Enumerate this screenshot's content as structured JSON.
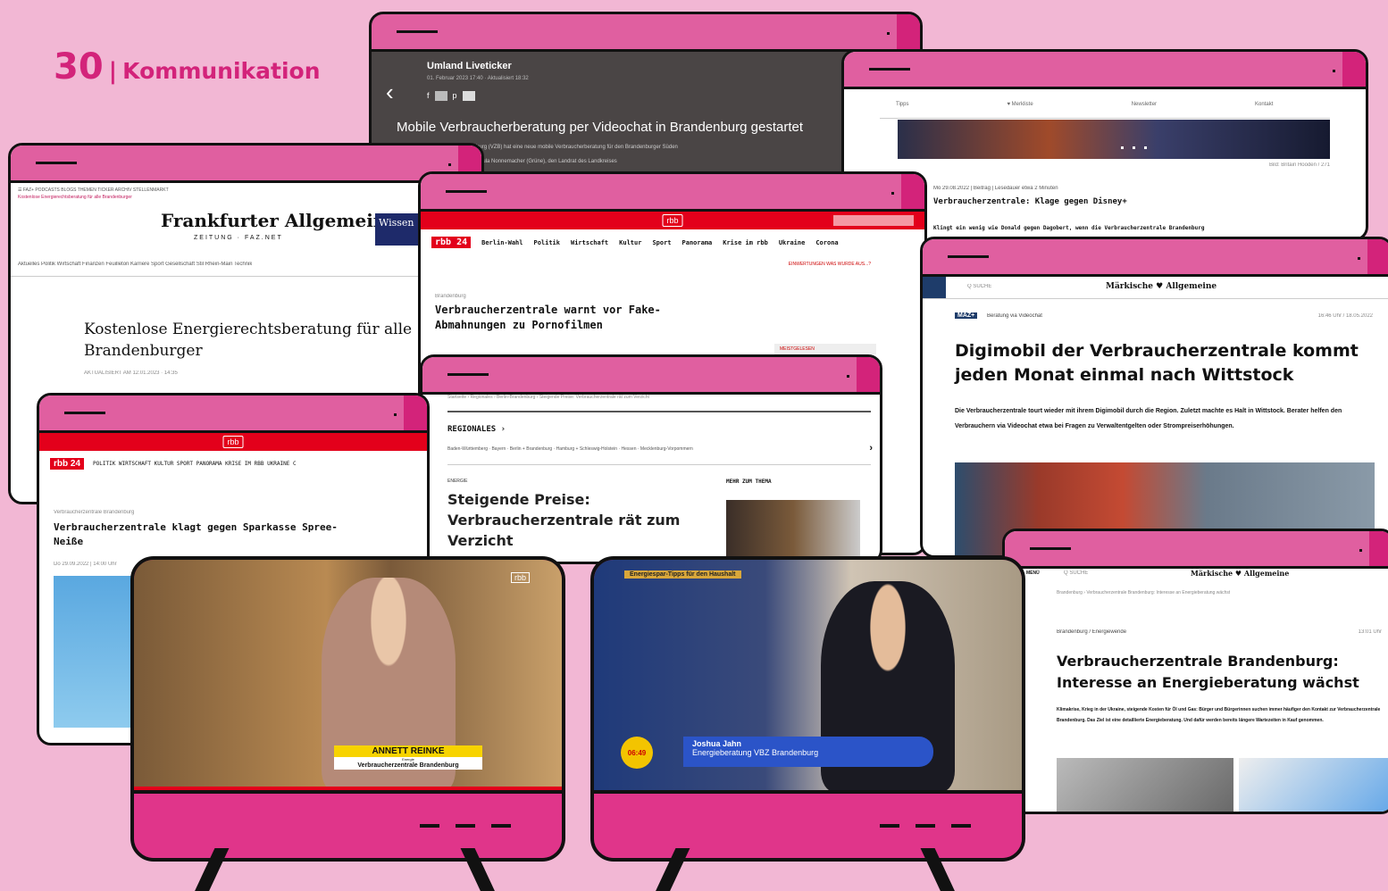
{
  "page_header": {
    "number": "30",
    "separator": "|",
    "section": "Kommunikation"
  },
  "win_live": {
    "kicker": "Umland Liveticker",
    "meta": "01. Februar 2023 17:40 · Aktualisiert 18:32",
    "headline": "Mobile Verbraucherberatung per Videochat in Brandenburg gestartet",
    "teaser1": "Die Verbraucherzentrale Brandenburg (VZB) hat eine neue mobile Verbraucherberatung für den Brandenburger Süden",
    "teaser2": "mit Verbraucherschutzministerin Ursula Nonnemacher (Grüne), den Landrat des Landkreises"
  },
  "win_disney": {
    "nav": [
      "Tipps",
      "♥ Merkliste",
      "Newsletter",
      "Kontakt"
    ],
    "credit": "Bild: Britain Hooden / 271",
    "meta": "Mo 29.08.2022 | Beitrag | Lesedauer etwa 2 Minuten",
    "headline": "Verbraucherzentrale: Klage gegen Disney+",
    "teaser": "Klingt ein wenig wie Donald gegen Dagobert, wenn die Verbraucherzentrale Brandenburg"
  },
  "win_faz": {
    "topnav": "☰  FAZ+  PODCASTS  BLOGS  THEMEN  TICKER  ARCHIV  STELLENMARKT",
    "breadcrumb": "Kostenlose Energierechtsberatung für alle Brandenburger",
    "logo": "Frankfurter Allgemeine",
    "logo_sub": "ZEITUNG · FAZ.NET",
    "ad": "Wissen · Gold we",
    "nav": "Aktuelles  Politik  Wirtschaft  Finanzen  Feuilleton  Karriere  Sport  Gesellschaft  Stil  Rhein-Main  Technik",
    "headline": "Kostenlose Energierechtsberatung für alle Brandenburger",
    "meta": "AKTUALISIERT AM 12.01.2023 · 14:35"
  },
  "win_rbb_fake": {
    "logo": "rbb",
    "badge": "rbb 24",
    "nav": [
      "Berlin-Wahl",
      "Politik",
      "Wirtschaft",
      "Kultur",
      "Sport",
      "Panorama",
      "Krise im rbb",
      "Ukraine",
      "Corona"
    ],
    "subnav": "EINWERTUNGEN    WAS WURDE AUS...?",
    "kicker": "Brandenburg",
    "headline": "Verbraucherzentrale warnt vor Fake-Abmahnungen zu Pornofilmen",
    "side": "MEISTGELESEN"
  },
  "win_maz1": {
    "search": "Q  SUCHE",
    "logo": "Märkische ♥ Allgemeine",
    "badge": "MAZ+",
    "kicker": "Beratung via Videochat",
    "time": "16:46 Uhr / 18.05.2022",
    "headline": "Digimobil der Verbraucherzentrale kommt jeden Monat einmal nach Wittstock",
    "teaser": "Die Verbraucherzentrale tourt wieder mit ihrem Digimobil durch die Region. Zuletzt machte es Halt in Wittstock. Berater helfen den Verbrauchern via Videochat etwa bei Fragen zu Verwaltentgelten oder Strompreiserhöhungen."
  },
  "win_regional": {
    "breadcrumb": "Startseite › Regionales › Berlin-Brandenburg › Steigende Preise: Verbraucherzentrale rät zum Verzicht",
    "section": "REGIONALES ›",
    "nav": "Baden-Württemberg · Bayern · Berlin + Brandenburg · Hamburg + Schleswig-Holstein · Hessen · Mecklenburg-Vorpommern",
    "kicker": "ENERGIE",
    "headline": "Steigende Preise: Verbraucherzentrale rät zum Verzicht",
    "side": "MEHR ZUM THEMA"
  },
  "win_rbb_klage": {
    "logo": "rbb",
    "badge": "rbb 24",
    "nav": "POLITIK  WIRTSCHAFT  KULTUR  SPORT  PANORAMA  KRISE IM RBB  UKRAINE  C",
    "kicker": "Verbraucherzentrale Brandenburg",
    "headline": "Verbraucherzentrale klagt gegen Sparkasse Spree-Neiße",
    "meta": "Do 29.09.2022 | 14:00 Uhr"
  },
  "win_maz2": {
    "menu": "MENÜ",
    "search": "Q  SUCHE",
    "logo": "Märkische ♥ Allgemeine",
    "breadcrumb": "Brandenburg › Verbraucherzentrale Brandenburg: Interesse an Energieberatung wächst",
    "kicker": "Brandenburg / Energiewende",
    "time": "13:01 Uhr",
    "headline": "Verbraucherzentrale Brandenburg: Interesse an Energieberatung wächst",
    "teaser": "Klimakrise, Krieg in der Ukraine, steigende Kosten für Öl und Gas: Bürger und Bürgerinnen suchen immer häufiger den Kontakt zur Verbraucherzentrale Brandenburg. Das Ziel ist eine detaillierte Energieberatung. Und dafür werden bereits längere Wartezeiten in Kauf genommen."
  },
  "tv1": {
    "channel": "rbb",
    "name": "ANNETT REINKE",
    "role_small": "Energie",
    "org": "Verbraucherzentrale Brandenburg"
  },
  "tv2": {
    "topic": "Energiespar-Tipps für den Haushalt",
    "name": "Joshua Jahn",
    "role": "Energieberatung VBZ Brandenburg",
    "clock": "06:49"
  },
  "colors": {
    "background": "#f2b7d4",
    "accent": "#d3237a",
    "frame_bar": "#e05fa0",
    "rbb_red": "#e3001b"
  }
}
